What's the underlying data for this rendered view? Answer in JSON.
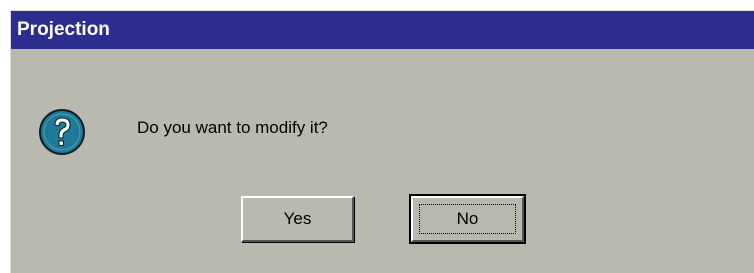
{
  "dialog": {
    "title": "Projection",
    "message": "Do you want to modify it?",
    "icon": "question-icon",
    "colors": {
      "titlebar": "#2b2d8f",
      "face": "#bab9b0",
      "icon_fill": "#1e7a96"
    },
    "buttons": {
      "yes_label": "Yes",
      "no_label": "No"
    },
    "default_button": "No"
  }
}
